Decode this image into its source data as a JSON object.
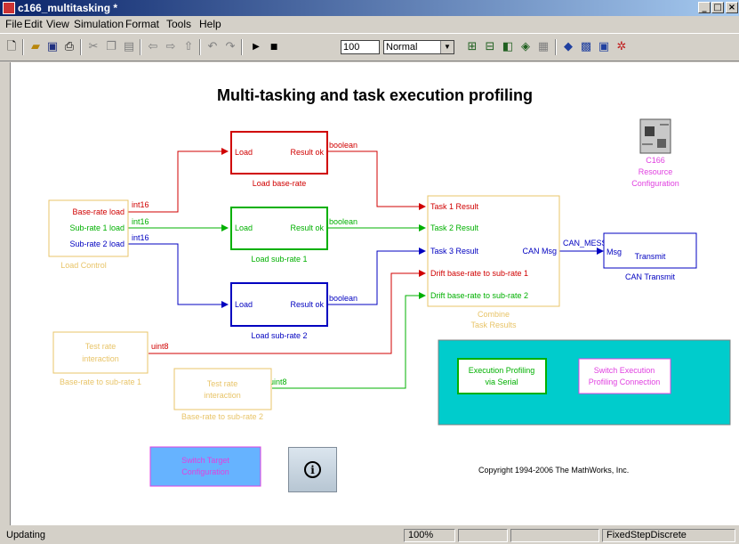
{
  "window": {
    "title": "c166_multitasking *"
  },
  "menu": [
    "File",
    "Edit",
    "View",
    "Simulation",
    "Format",
    "Tools",
    "Help"
  ],
  "toolbar": {
    "stop_time": "100",
    "sim_mode": "Normal"
  },
  "canvas": {
    "title": "Multi-tasking and task execution profiling",
    "copyright": "Copyright 1994-2006 The MathWorks, Inc.",
    "load_control": {
      "ports": [
        "Base-rate load",
        "Sub-rate 1 load",
        "Sub-rate 2 load"
      ],
      "caption": "Load Control"
    },
    "load_blocks": [
      {
        "in": "Load",
        "out": "Result ok",
        "caption": "Load base-rate"
      },
      {
        "in": "Load",
        "out": "Result ok",
        "caption": "Load sub-rate 1"
      },
      {
        "in": "Load",
        "out": "Result ok",
        "caption": "Load sub-rate 2"
      }
    ],
    "signals": {
      "int16": "int16",
      "boolean": "boolean",
      "uint8": "uint8",
      "can_msg": "CAN_MESSAGE_EXTENDED"
    },
    "combine": {
      "ports": [
        "Task 1 Result",
        "Task 2 Result",
        "Task 3 Result",
        "Drift base-rate to sub-rate 1",
        "Drift base-rate to sub-rate 2"
      ],
      "out": "CAN Msg",
      "caption1": "Combine",
      "caption2": "Task Results"
    },
    "can_transmit": {
      "in": "Msg",
      "label": "Transmit",
      "caption": "CAN Transmit"
    },
    "resource": {
      "l1": "C166",
      "l2": "Resource",
      "l3": "Configuration"
    },
    "test1": {
      "l1": "Test rate",
      "l2": "interaction",
      "caption": "Base-rate to sub-rate 1"
    },
    "test2": {
      "l1": "Test rate",
      "l2": "interaction",
      "caption": "Base-rate to sub-rate 2"
    },
    "exec_profiling": {
      "l1": "Execution Profiling",
      "l2": "via Serial"
    },
    "switch_exec": {
      "l1": "Switch Execution",
      "l2": "Profiling Connection"
    },
    "switch_target": {
      "l1": "Switch Target",
      "l2": "Configuration"
    }
  },
  "status": {
    "text": "Updating",
    "zoom": "100%",
    "solver": "FixedStepDiscrete"
  }
}
